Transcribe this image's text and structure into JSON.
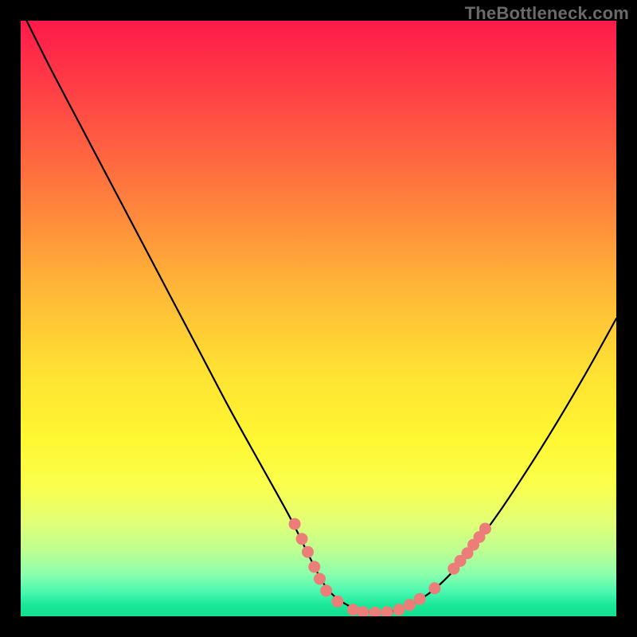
{
  "watermark": "TheBottleneck.com",
  "colors": {
    "gradient_top": "#ff1a4b",
    "gradient_mid": "#ffdf33",
    "gradient_bottom": "#12e08f",
    "curve": "#000000",
    "dots": "#eb7e78",
    "frame": "#000000"
  },
  "chart_data": {
    "type": "line",
    "title": "",
    "xlabel": "",
    "ylabel": "",
    "xlim": [
      0,
      100
    ],
    "ylim": [
      0,
      100
    ],
    "grid": false,
    "legend": false,
    "series": [
      {
        "name": "bottleneck-curve",
        "x": [
          0,
          5,
          10,
          15,
          20,
          25,
          30,
          35,
          40,
          45,
          48,
          50,
          52,
          55,
          58,
          60,
          63,
          66,
          70,
          75,
          80,
          85,
          90,
          95,
          100
        ],
        "y": [
          102,
          92,
          82.5,
          73,
          63.5,
          54,
          44.5,
          35,
          26,
          17,
          11,
          7,
          4,
          1.8,
          0.8,
          0.6,
          1.0,
          2.2,
          5,
          10.3,
          17,
          24.5,
          32.5,
          41,
          50
        ]
      }
    ],
    "markers": {
      "name": "highlight-dots",
      "points": [
        {
          "x": 46.0,
          "y": 15.5
        },
        {
          "x": 47.2,
          "y": 13.0
        },
        {
          "x": 48.2,
          "y": 10.8
        },
        {
          "x": 49.3,
          "y": 8.3
        },
        {
          "x": 50.2,
          "y": 6.3
        },
        {
          "x": 51.3,
          "y": 4.3
        },
        {
          "x": 53.2,
          "y": 2.5
        },
        {
          "x": 55.8,
          "y": 1.1
        },
        {
          "x": 57.5,
          "y": 0.7
        },
        {
          "x": 59.5,
          "y": 0.6
        },
        {
          "x": 61.5,
          "y": 0.7
        },
        {
          "x": 63.5,
          "y": 1.1
        },
        {
          "x": 65.3,
          "y": 1.9
        },
        {
          "x": 67.0,
          "y": 2.9
        },
        {
          "x": 69.5,
          "y": 4.7
        },
        {
          "x": 72.7,
          "y": 8.0
        },
        {
          "x": 73.8,
          "y": 9.3
        },
        {
          "x": 75.0,
          "y": 10.6
        },
        {
          "x": 76.0,
          "y": 12.0
        },
        {
          "x": 77.0,
          "y": 13.3
        },
        {
          "x": 78.0,
          "y": 14.7
        }
      ]
    }
  }
}
